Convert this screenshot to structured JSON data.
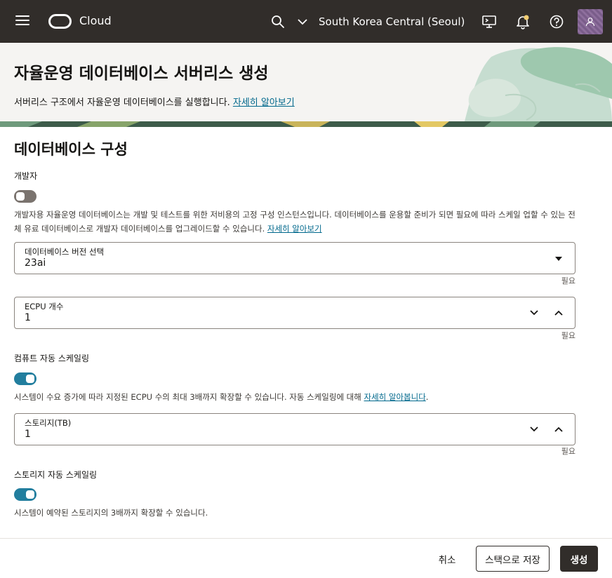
{
  "nav": {
    "brand": "Cloud",
    "region": "South Korea Central (Seoul)",
    "icons": [
      "menu-icon",
      "oracle-logo-icon",
      "search-icon",
      "chevron-down-icon",
      "cloud-shell-icon",
      "bell-icon",
      "help-icon",
      "user-icon"
    ],
    "notification_dot_color": "#f0cc71"
  },
  "header": {
    "title": "자율운영 데이터베이스 서버리스 생성",
    "description": "서버리스 구조에서 자율운영 데이터베이스를 실행합니다.",
    "learn_more": "자세히 알아보기"
  },
  "config": {
    "section_title": "데이터베이스 구성",
    "developer": {
      "label": "개발자",
      "enabled": false,
      "helper": "개발자용 자율운영 데이터베이스는 개발 및 테스트를 위한 저비용의 고정 구성 인스턴스입니다. 데이터베이스를 운용할 준비가 되면 필요에 따라 스케일 업할 수 있는 전체 유료 데이터베이스로 개발자 데이터베이스를 업그레이드할 수 있습니다.",
      "learn_more": "자세히 알아보기"
    },
    "db_version": {
      "label": "데이터베이스 버전 선택",
      "value": "23ai",
      "required": "필요"
    },
    "ecpu": {
      "label": "ECPU 개수",
      "value": "1",
      "required": "필요"
    },
    "compute_autoscale": {
      "label": "컴퓨트 자동 스케일링",
      "enabled": true,
      "helper": "시스템이 수요 증가에 따라 지정된 ECPU 수의 최대 3배까지 확장할 수 있습니다. 자동 스케일링에 대해 ",
      "learn_more": "자세히 알아봅니다",
      "helper_end": "."
    },
    "storage": {
      "label": "스토리지(TB)",
      "value": "1",
      "required": "필요"
    },
    "storage_autoscale": {
      "label": "스토리지 자동 스케일링",
      "enabled": true,
      "helper": "시스템이 예약된 스토리지의 3배까지 확장할 수 있습니다."
    }
  },
  "footer": {
    "cancel": "취소",
    "save_stack": "스택으로 저장",
    "create": "생성"
  },
  "colors": {
    "topbar": "#312d2a",
    "accent": "#227e9e",
    "link": "#00688c"
  }
}
